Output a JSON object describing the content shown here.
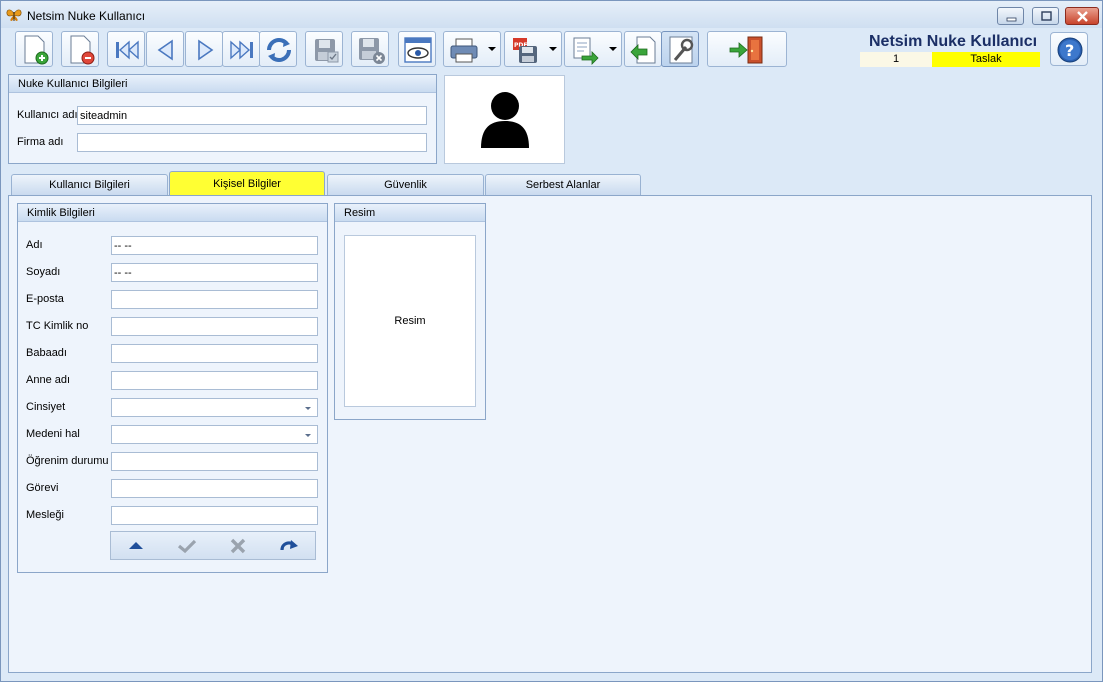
{
  "window": {
    "title": "Netsim Nuke Kullanıcı"
  },
  "header": {
    "app_title": "Netsim Nuke Kullanıcı",
    "record_no": "1",
    "record_status": "Taslak",
    "status_color": "#ffff00"
  },
  "toolbar": {
    "buttons": [
      "new-record-icon",
      "delete-record-icon",
      "first-record-icon",
      "previous-record-icon",
      "next-record-icon",
      "last-record-icon",
      "refresh-icon",
      "save-icon",
      "save-cancel-icon",
      "preview-icon",
      "print-icon",
      "pdf-export-icon",
      "export-icon",
      "import-icon",
      "settings-icon",
      "exit-icon"
    ]
  },
  "user_info": {
    "group_title": "Nuke Kullanıcı Bilgileri",
    "username_label": "Kullanıcı adı",
    "username_value": "siteadmin",
    "company_label": "Firma adı",
    "company_value": ""
  },
  "tabs": [
    {
      "label": "Kullanıcı Bilgileri",
      "active": false
    },
    {
      "label": "Kişisel Bilgiler",
      "active": true
    },
    {
      "label": "Güvenlik",
      "active": false
    },
    {
      "label": "Serbest Alanlar",
      "active": false
    }
  ],
  "identity": {
    "group_title": "Kimlik Bilgileri",
    "fields": [
      {
        "label": "Adı",
        "value": "-- --"
      },
      {
        "label": "Soyadı",
        "value": "-- --"
      },
      {
        "label": "E-posta",
        "value": ""
      },
      {
        "label": "TC Kimlik no",
        "value": ""
      },
      {
        "label": "Babaadı",
        "value": ""
      },
      {
        "label": "Anne adı",
        "value": ""
      },
      {
        "label": "Cinsiyet",
        "value": ""
      },
      {
        "label": "Medeni hal",
        "value": ""
      },
      {
        "label": "Öğrenim durumu",
        "value": ""
      },
      {
        "label": "Görevi",
        "value": ""
      },
      {
        "label": "Mesleği",
        "value": ""
      }
    ]
  },
  "picture": {
    "group_title": "Resim",
    "placeholder": "Resim"
  }
}
